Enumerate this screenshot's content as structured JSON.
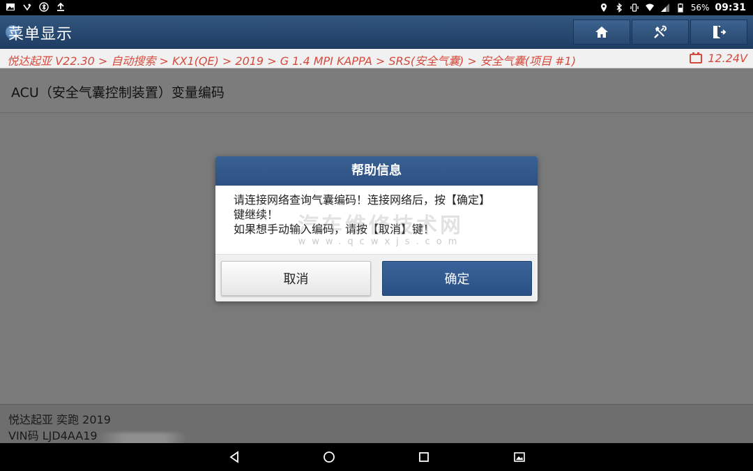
{
  "status_bar": {
    "battery_percent": "56%",
    "time": "09:31",
    "icons_left": [
      "image-icon",
      "voicemail-icon",
      "bluetooth-settings-icon",
      "upload-icon"
    ],
    "icons_right": [
      "location-icon",
      "bluetooth-icon",
      "vibrate-icon",
      "wifi-icon",
      "signal-icon",
      "battery-icon"
    ]
  },
  "header": {
    "title": "菜单显示",
    "buttons": [
      "home-icon",
      "diagnose-icon",
      "exit-icon"
    ]
  },
  "breadcrumb": {
    "path": "悦达起亚 V22.30 > 自动搜索 > KX1(QE) > 2019 > G 1.4 MPI KAPPA > SRS(安全气囊) > 安全气囊(项目 #1)",
    "voltage": "12.24V"
  },
  "page": {
    "title": "ACU（安全气囊控制装置）变量编码"
  },
  "dialog": {
    "title": "帮助信息",
    "message": "请连接网络查询气囊编码！连接网络后，按【确定】\n键继续！\n如果想手动输入编码，请按【取消】键！",
    "cancel_label": "取消",
    "ok_label": "确定",
    "watermark_cn": "汽车维修技术网",
    "watermark_en": "www.qcwxjs.com"
  },
  "footer": {
    "vehicle": "悦达起亚 奕跑 2019",
    "vin": "VIN码 LJD4AA19"
  },
  "colors": {
    "header_blue": "#2c5182",
    "breadcrumb_red": "#d64a3d"
  }
}
